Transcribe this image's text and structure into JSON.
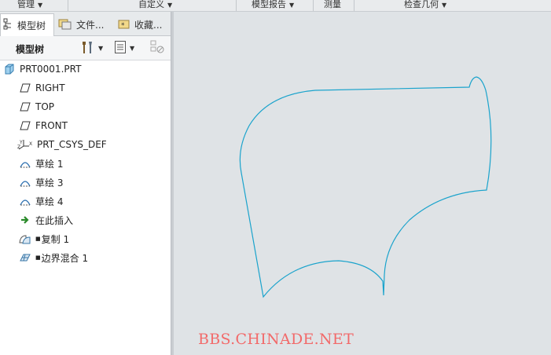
{
  "ribbon": {
    "groups": [
      {
        "label": "管理",
        "has_menu": true
      },
      {
        "label": "自定义",
        "has_menu": true
      },
      {
        "label": "模型报告",
        "has_menu": true
      },
      {
        "label": "测量",
        "has_menu": false
      },
      {
        "label": "检查几何",
        "has_menu": true
      }
    ]
  },
  "navigator": {
    "tabs": [
      {
        "label": "模型树",
        "active": true
      },
      {
        "label": "文件...",
        "active": false
      },
      {
        "label": "收藏...",
        "active": false
      }
    ],
    "toolbar_title": "模型树",
    "tree": [
      {
        "label": "PRT0001.PRT",
        "icon": "part-icon"
      },
      {
        "label": "RIGHT",
        "icon": "datum-plane-icon"
      },
      {
        "label": "TOP",
        "icon": "datum-plane-icon"
      },
      {
        "label": "FRONT",
        "icon": "datum-plane-icon"
      },
      {
        "label": "PRT_CSYS_DEF",
        "icon": "csys-icon"
      },
      {
        "label": "草绘 1",
        "icon": "sketch-icon"
      },
      {
        "label": "草绘 3",
        "icon": "sketch-icon"
      },
      {
        "label": "草绘 4",
        "icon": "sketch-icon"
      },
      {
        "label": "在此插入",
        "icon": "insert-here-arrow-icon"
      },
      {
        "label": "复制 1",
        "icon": "copy-surface-icon"
      },
      {
        "label": "边界混合 1",
        "icon": "boundary-blend-icon"
      }
    ]
  },
  "watermark": "BBS.CHINADE.NET",
  "colors": {
    "curve": "#1aa3cc",
    "watermark": "#f26a6a",
    "canvas_bg": "#dfe3e6"
  }
}
